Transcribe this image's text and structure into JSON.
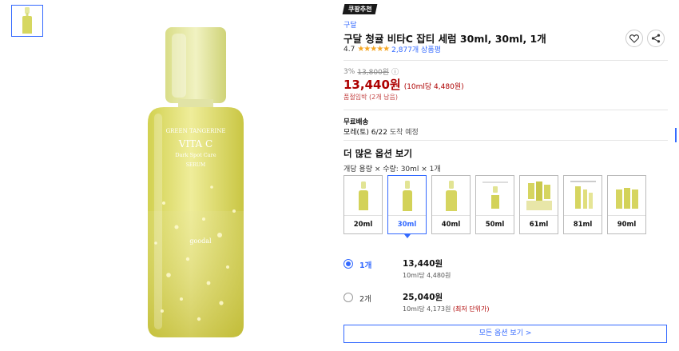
{
  "badge": "쿠팡추천",
  "brand": "구달",
  "title": "구달 청귤 비타C 잡티 세럼 30ml, 30ml, 1개",
  "rating": {
    "score": "4.7",
    "stars": "★★★★★",
    "count": "2,877개 상품평"
  },
  "price": {
    "discount": "3%",
    "original": "13,800원",
    "info_icon": "ⓘ",
    "current": "13,440원",
    "unit_price": "(10ml당 4,480원)",
    "stock_note": "품절임박 (2개 남음)"
  },
  "shipping": {
    "label": "무료배송",
    "date": "모레(토) 6/22",
    "date_suffix": "도착 예정"
  },
  "options": {
    "heading": "더 많은 옵션 보기",
    "selection_line": "개당 용량 × 수량: 30ml × 1개",
    "sizes": [
      {
        "label": "20ml"
      },
      {
        "label": "30ml"
      },
      {
        "label": "40ml"
      },
      {
        "label": "50ml"
      },
      {
        "label": "61ml"
      },
      {
        "label": "81ml"
      },
      {
        "label": "90ml"
      }
    ],
    "selected_index": 1
  },
  "quantities": [
    {
      "label": "1개",
      "price": "13,440원",
      "unit": "10ml당 4,480원",
      "lowest": "",
      "selected": true
    },
    {
      "label": "2개",
      "price": "25,040원",
      "unit": "10ml당 4,173원",
      "lowest": "(최저 단위가)",
      "selected": false
    }
  ],
  "all_options_button": "모든 옵션 보기 >",
  "product_label": {
    "line1": "GREEN TANGERINE",
    "line2": "VITA C",
    "line3": "Dark Spot Care",
    "line4": "SERUM",
    "brand": "goodal"
  },
  "colors": {
    "accent": "#346aff",
    "price_red": "#ae0000",
    "star": "#f5a623",
    "serum": "#e3e184"
  }
}
